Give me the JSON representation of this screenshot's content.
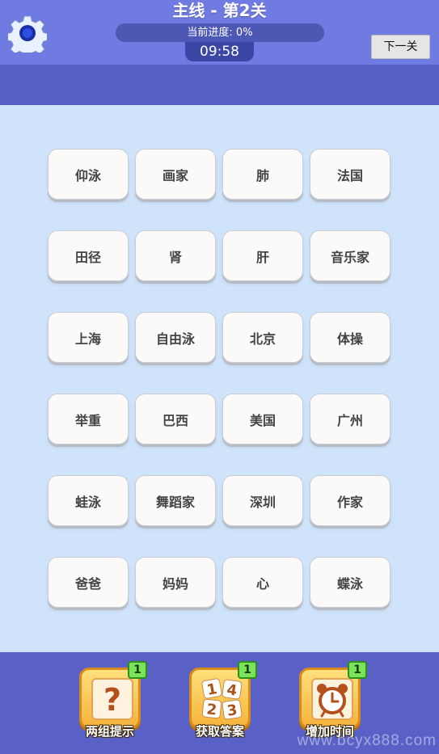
{
  "header": {
    "title": "主线 - 第2关",
    "progress_text": "当前进度: 0%",
    "timer": "09:58",
    "next_button": "下一关"
  },
  "tiles": [
    "仰泳",
    "画家",
    "肺",
    "法国",
    "田径",
    "肾",
    "肝",
    "音乐家",
    "上海",
    "自由泳",
    "北京",
    "体操",
    "举重",
    "巴西",
    "美国",
    "广州",
    "蛙泳",
    "舞蹈家",
    "深圳",
    "作家",
    "爸爸",
    "妈妈",
    "心",
    "蝶泳"
  ],
  "powerups": [
    {
      "label": "两组提示",
      "count": "1",
      "icon": "question-icon"
    },
    {
      "label": "获取答案",
      "count": "1",
      "icon": "number-tiles-icon",
      "digits": [
        "1",
        "4",
        "2",
        "3"
      ]
    },
    {
      "label": "增加时间",
      "count": "1",
      "icon": "alarm-clock-icon"
    }
  ],
  "watermark": "www.bcyx888.com",
  "colors": {
    "header_bg": "#6f7be0",
    "subbar_bg": "#5560c4",
    "board_bg": "#cfe3fb",
    "bottom_bg": "#5961c6",
    "powerup_yellow": "#f6b33b",
    "badge_green": "#7ce25a"
  }
}
